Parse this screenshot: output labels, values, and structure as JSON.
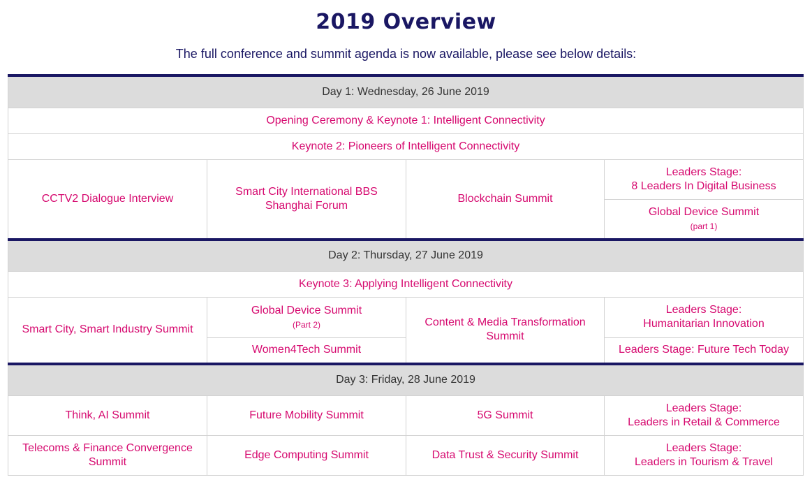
{
  "page": {
    "title": "2019 Overview",
    "subtitle": "The full conference and summit agenda is now available, please see below details:"
  },
  "colors": {
    "heading": "#1a1763",
    "accent": "#d6096f",
    "day_header_bg": "#dcdcdc",
    "day_border": "#1a1763"
  },
  "day1": {
    "header": "Day 1: Wednesday, 26 June 2019",
    "opening": "Opening Ceremony & Keynote 1: Intelligent Connectivity",
    "keynote2": "Keynote 2: Pioneers of Intelligent Connectivity",
    "cctv2": "CCTV2 Dialogue Interview",
    "smart_city_bbs_line1": "Smart City International BBS",
    "smart_city_bbs_line2": "Shanghai Forum",
    "blockchain": "Blockchain Summit",
    "leaders_stage_line1": "Leaders Stage:",
    "leaders_stage_line2": "8 Leaders In Digital Business",
    "global_device": "Global Device Summit",
    "global_device_note": "(part 1)"
  },
  "day2": {
    "header": "Day 2: Thursday, 27 June 2019",
    "keynote3": "Keynote 3: Applying Intelligent Connectivity",
    "smart_industry": "Smart City, Smart Industry Summit",
    "global_device": "Global Device Summit",
    "global_device_note": "(Part 2)",
    "women4tech": "Women4Tech Summit",
    "content_media_line1": "Content & Media Transformation",
    "content_media_line2": "Summit",
    "leaders_humanitarian_line1": "Leaders Stage:",
    "leaders_humanitarian_line2": "Humanitarian Innovation",
    "leaders_future_tech": "Leaders Stage: Future Tech Today"
  },
  "day3": {
    "header": "Day 3: Friday, 28 June 2019",
    "think_ai": "Think, AI Summit",
    "future_mobility": "Future Mobility Summit",
    "five_g": "5G Summit",
    "leaders_retail_line1": "Leaders Stage:",
    "leaders_retail_line2": "Leaders in Retail & Commerce",
    "telecoms_line1": "Telecoms & Finance Convergence",
    "telecoms_line2": "Summit",
    "edge_computing": "Edge Computing Summit",
    "data_trust": "Data Trust & Security Summit",
    "leaders_tourism_line1": "Leaders Stage:",
    "leaders_tourism_line2": "Leaders in Tourism & Travel"
  }
}
